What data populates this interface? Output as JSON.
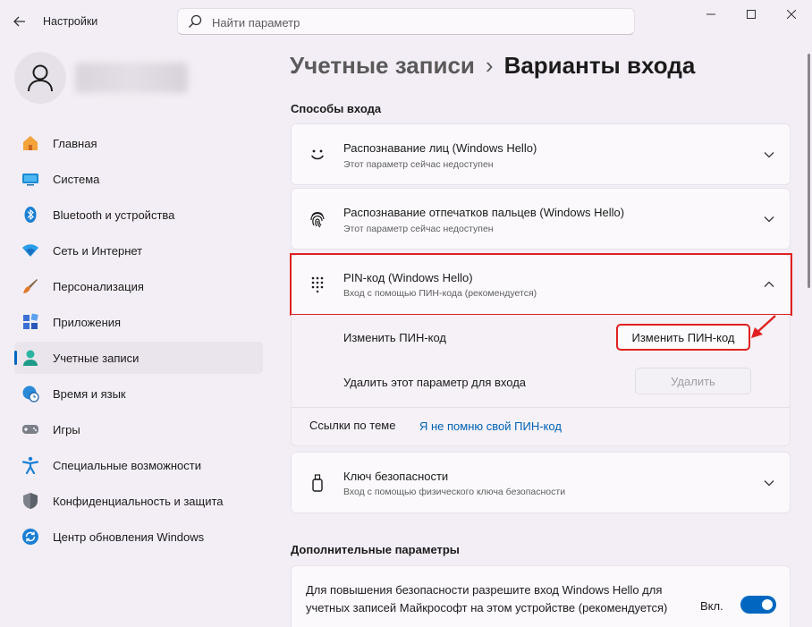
{
  "window": {
    "title": "Настройки",
    "search_placeholder": "Найти параметр"
  },
  "sidebar": {
    "items": [
      {
        "label": "Главная",
        "icon": "home-icon"
      },
      {
        "label": "Система",
        "icon": "system-icon"
      },
      {
        "label": "Bluetooth и устройства",
        "icon": "bluetooth-icon"
      },
      {
        "label": "Сеть и Интернет",
        "icon": "wifi-icon"
      },
      {
        "label": "Персонализация",
        "icon": "brush-icon"
      },
      {
        "label": "Приложения",
        "icon": "apps-icon"
      },
      {
        "label": "Учетные записи",
        "icon": "account-icon",
        "active": true
      },
      {
        "label": "Время и язык",
        "icon": "clock-globe-icon"
      },
      {
        "label": "Игры",
        "icon": "gamepad-icon"
      },
      {
        "label": "Специальные возможности",
        "icon": "accessibility-icon"
      },
      {
        "label": "Конфиденциальность и защита",
        "icon": "shield-icon"
      },
      {
        "label": "Центр обновления Windows",
        "icon": "update-icon"
      }
    ]
  },
  "breadcrumb": {
    "parent": "Учетные записи",
    "separator": "›",
    "current": "Варианты входа"
  },
  "sign_in": {
    "section_title": "Способы входа",
    "face": {
      "title": "Распознавание лиц (Windows Hello)",
      "subtitle": "Этот параметр сейчас недоступен"
    },
    "fingerprint": {
      "title": "Распознавание отпечатков пальцев (Windows Hello)",
      "subtitle": "Этот параметр сейчас недоступен"
    },
    "pin": {
      "title": "PIN-код (Windows Hello)",
      "subtitle": "Вход с помощью ПИН-кода (рекомендуется)",
      "change_label": "Изменить ПИН-код",
      "change_button": "Изменить ПИН-код",
      "remove_label": "Удалить этот параметр для входа",
      "remove_button": "Удалить",
      "related_label": "Ссылки по теме",
      "forgot_link": "Я не помню свой ПИН-код"
    },
    "security_key": {
      "title": "Ключ безопасности",
      "subtitle": "Вход с помощью физического ключа безопасности"
    }
  },
  "additional": {
    "section_title": "Дополнительные параметры",
    "hello_only_text": "Для повышения безопасности разрешите вход Windows Hello для учетных записей Майкрософт на этом устройстве (рекомендуется)",
    "toggle_label": "Вкл.",
    "toggle_on": true
  },
  "colors": {
    "accent": "#0067c0",
    "highlight": "#e02020",
    "link": "#0062b4"
  }
}
